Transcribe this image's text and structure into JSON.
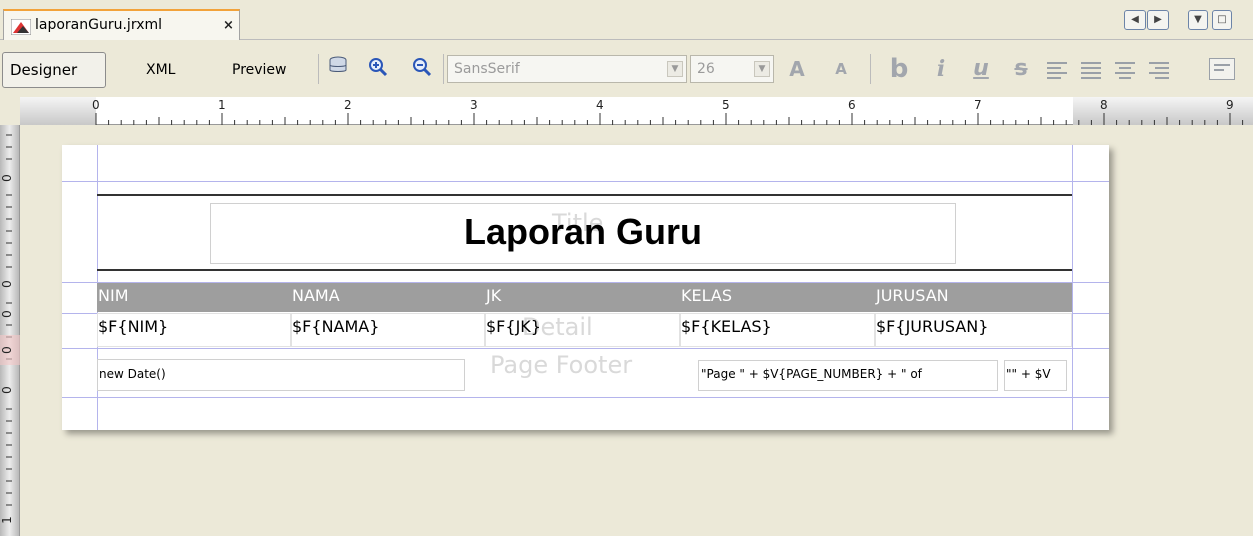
{
  "file_tab": {
    "name": "laporanGuru.jrxml",
    "close": "×"
  },
  "window_controls": {
    "prev": "◀",
    "next": "▶",
    "menu": "▼",
    "maximize": "□"
  },
  "view_tabs": [
    "Designer",
    "XML",
    "Preview"
  ],
  "toolbar": {
    "font_name": "SansSerif",
    "font_size": "26",
    "grow_font": "A",
    "shrink_font": "A",
    "bold": "b",
    "italic": "i",
    "underline": "u",
    "strike": "s"
  },
  "ruler": {
    "ticks": [
      "0",
      "1",
      "2",
      "3",
      "4",
      "5",
      "6",
      "7",
      "8",
      "9"
    ],
    "side": [
      "0",
      "0",
      "0",
      "0",
      "0",
      "1"
    ]
  },
  "report": {
    "title_text": "Laporan Guru",
    "band_labels": {
      "title": "Title",
      "detail": "Detail",
      "page_footer": "Page Footer"
    },
    "column_headers": [
      "NIM",
      "NAMA",
      "JK",
      "KELAS",
      "JURUSAN"
    ],
    "detail_fields": [
      "$F{NIM}",
      "$F{NAMA}",
      "$F{JK}",
      "$F{KELAS}",
      "$F{JURUSAN}"
    ],
    "footer": {
      "date_expr": "new Date()",
      "page_expr": "\"Page \" + $V{PAGE_NUMBER} + \" of",
      "total_expr": "\"\" + $V"
    }
  },
  "colors": {
    "header_bg": "#9e9e9e",
    "guide": "#b4b4ec",
    "tab_accent": "#f2a23a"
  }
}
